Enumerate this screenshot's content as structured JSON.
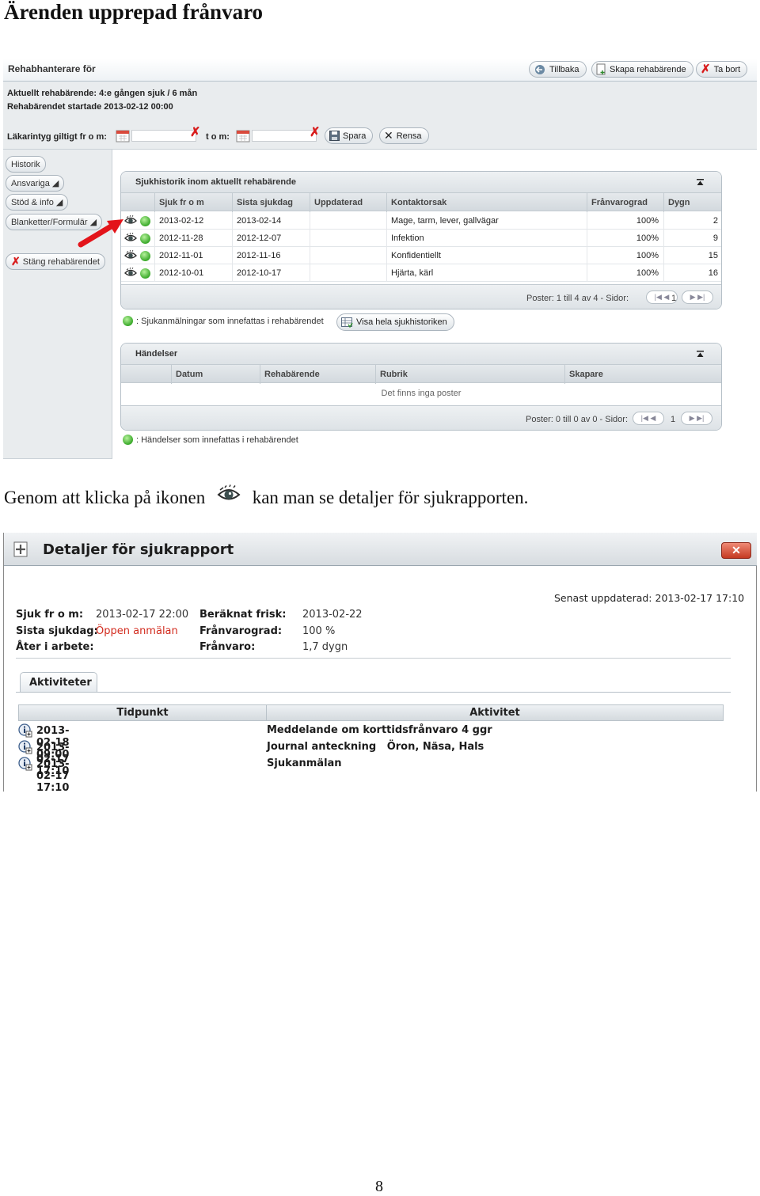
{
  "document": {
    "heading": "Ärenden upprepad frånvaro",
    "text_before_icon": "Genom att klicka på ikonen",
    "text_after_icon": "kan man se detaljer för sjukrapporten.",
    "page_number": "8"
  },
  "screen1": {
    "title": "Rehabhanterare för",
    "buttons": {
      "back": "Tillbaka",
      "create": "Skapa rehabärende",
      "delete": "Ta bort",
      "save": "Spara",
      "clear": "Rensa"
    },
    "current_case": "Aktuellt rehabärende: 4:e gången sjuk / 6 mån",
    "case_started": "Rehabärendet startade 2013-02-12 00:00",
    "cert_label": "Läkarintyg giltigt fr o m:",
    "cert_to_label": "t o m:",
    "sidebar": [
      "Historik",
      "Ansvariga",
      "Stöd & info",
      "Blanketter/Formulär",
      "Stäng rehabärendet"
    ],
    "history_panel": {
      "title": "Sjukhistorik inom aktuellt rehabärende",
      "columns": [
        "Sjuk fr o m",
        "Sista sjukdag",
        "Uppdaterad",
        "Kontaktorsak",
        "Frånvarograd",
        "Dygn"
      ],
      "rows": [
        {
          "from": "2013-02-12",
          "last": "2013-02-14",
          "updated": "",
          "reason": "Mage, tarm, lever, gallvägar",
          "degree": "100%",
          "days": "2"
        },
        {
          "from": "2012-11-28",
          "last": "2012-12-07",
          "updated": "",
          "reason": "Infektion",
          "degree": "100%",
          "days": "9"
        },
        {
          "from": "2012-11-01",
          "last": "2012-11-16",
          "updated": "",
          "reason": "Konfidentiellt",
          "degree": "100%",
          "days": "15"
        },
        {
          "from": "2012-10-01",
          "last": "2012-10-17",
          "updated": "",
          "reason": "Hjärta, kärl",
          "degree": "100%",
          "days": "16"
        }
      ],
      "pager_text": "Poster: 1 till 4 av 4 - Sidor:",
      "page": "1"
    },
    "history_legend": ": Sjukanmälningar som innefattas i rehabärendet",
    "show_history_button": "Visa hela sjukhistoriken",
    "events_panel": {
      "title": "Händelser",
      "columns": [
        "Datum",
        "Rehabärende",
        "Rubrik",
        "Skapare"
      ],
      "empty_text": "Det finns inga poster",
      "pager_text": "Poster: 0 till 0 av 0 - Sidor:",
      "page": "1"
    },
    "events_legend": ": Händelser som innefattas i rehabärendet"
  },
  "screen2": {
    "title": "Detaljer för sjukrapport",
    "close_label": "✕",
    "last_updated": "Senast uppdaterad: 2013-02-17 17:10",
    "fields": {
      "sick_from_label": "Sjuk fr o m:",
      "sick_from": "2013-02-17 22:00",
      "last_day_label": "Sista sjukdag:",
      "last_day": "Öppen anmälan",
      "return_label": "Åter i arbete:",
      "return": "",
      "estimated_label": "Beräknat frisk:",
      "estimated": "2013-02-22",
      "degree_label": "Frånvarograd:",
      "degree": "100 %",
      "absence_label": "Frånvaro:",
      "absence": "1,7 dygn"
    },
    "tab": "Aktiviteter",
    "activity_columns": [
      "Tidpunkt",
      "Aktivitet"
    ],
    "activities": [
      {
        "time": "2013-02-18 09:00",
        "activity": "Meddelande om korttidsfrånvaro 4 ggr"
      },
      {
        "time": "2013-02-17 17:10",
        "activity": "Journal anteckning   Öron, Näsa, Hals"
      },
      {
        "time": "2013-02-17 17:10",
        "activity": "Sjukanmälan"
      }
    ]
  }
}
